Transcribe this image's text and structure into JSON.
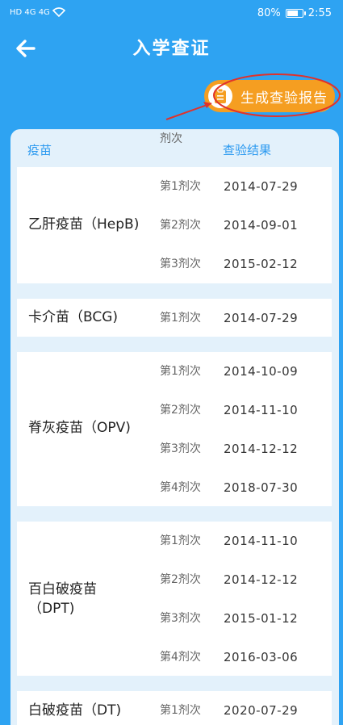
{
  "status_bar": {
    "carrier_icons": "HD 4G 4G",
    "battery": "80%",
    "battery_level": 0.8,
    "time": "2:55"
  },
  "header": {
    "title": "入学查证",
    "back_icon": "arrow-left-icon"
  },
  "report_button": {
    "label": "生成查验报告",
    "icon": "clipboard-icon",
    "color": "#f59e21"
  },
  "table": {
    "columns": [
      "疫苗",
      "剂次",
      "查验结果"
    ],
    "vaccines": [
      {
        "name": "乙肝疫苗（HepB)",
        "doses": [
          {
            "dose": "第1剂次",
            "date": "2014-07-29"
          },
          {
            "dose": "第2剂次",
            "date": "2014-09-01"
          },
          {
            "dose": "第3剂次",
            "date": "2015-02-12"
          }
        ]
      },
      {
        "name": "卡介苗（BCG)",
        "doses": [
          {
            "dose": "第1剂次",
            "date": "2014-07-29"
          }
        ]
      },
      {
        "name": "脊灰疫苗（OPV)",
        "doses": [
          {
            "dose": "第1剂次",
            "date": "2014-10-09"
          },
          {
            "dose": "第2剂次",
            "date": "2014-11-10"
          },
          {
            "dose": "第3剂次",
            "date": "2014-12-12"
          },
          {
            "dose": "第4剂次",
            "date": "2018-07-30"
          }
        ]
      },
      {
        "name": "百白破疫苗",
        "name2": "（DPT)",
        "doses": [
          {
            "dose": "第1剂次",
            "date": "2014-11-10"
          },
          {
            "dose": "第2剂次",
            "date": "2014-12-12"
          },
          {
            "dose": "第3剂次",
            "date": "2015-01-12"
          },
          {
            "dose": "第4剂次",
            "date": "2016-03-06"
          }
        ]
      },
      {
        "name": "白破疫苗（DT)",
        "doses": [
          {
            "dose": "第1剂次",
            "date": "2020-07-29"
          }
        ]
      }
    ]
  },
  "colors": {
    "background": "#2ea3f2",
    "header_text": "#2c9af0",
    "accent": "#f59e21",
    "annotation": "#e0322b"
  }
}
